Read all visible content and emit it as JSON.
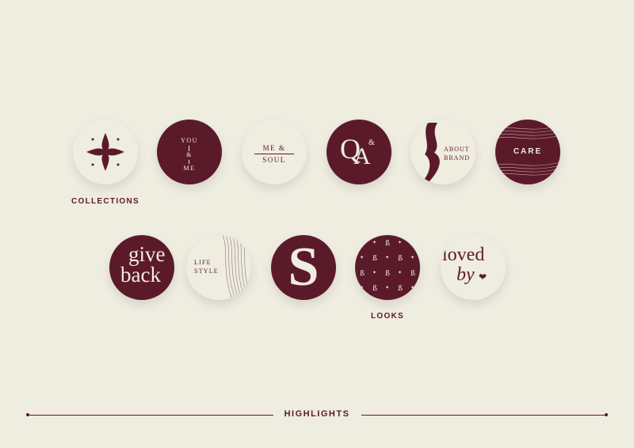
{
  "highlights": {
    "collections": {
      "caption": "COLLECTIONS"
    },
    "you_me": {
      "line1": "YOU",
      "amp": "&",
      "line2": "ME"
    },
    "me_soul": {
      "line1": "ME  &",
      "line2": "SOUL"
    },
    "qa": {
      "q": "Q",
      "amp": "&",
      "a": "A"
    },
    "about_brand": {
      "line1": "ABOUT",
      "line2": "BRAND"
    },
    "care": {
      "label": "CARE"
    },
    "give_back": {
      "line1": "give",
      "line2": "back"
    },
    "life_style": {
      "line1": "LIFE",
      "line2": "STYLE"
    },
    "s_logo": {
      "letter": "S"
    },
    "looks": {
      "caption": "LOOKS",
      "pattern_glyph": "ß",
      "star": "✦"
    },
    "loved_by": {
      "line1": "loved",
      "line2": "by",
      "heart": "❤"
    }
  },
  "footer": {
    "title": "HIGHLIGHTS"
  },
  "colors": {
    "background": "#efece0",
    "burgundy": "#5b1a2a",
    "cream": "#efece0"
  }
}
